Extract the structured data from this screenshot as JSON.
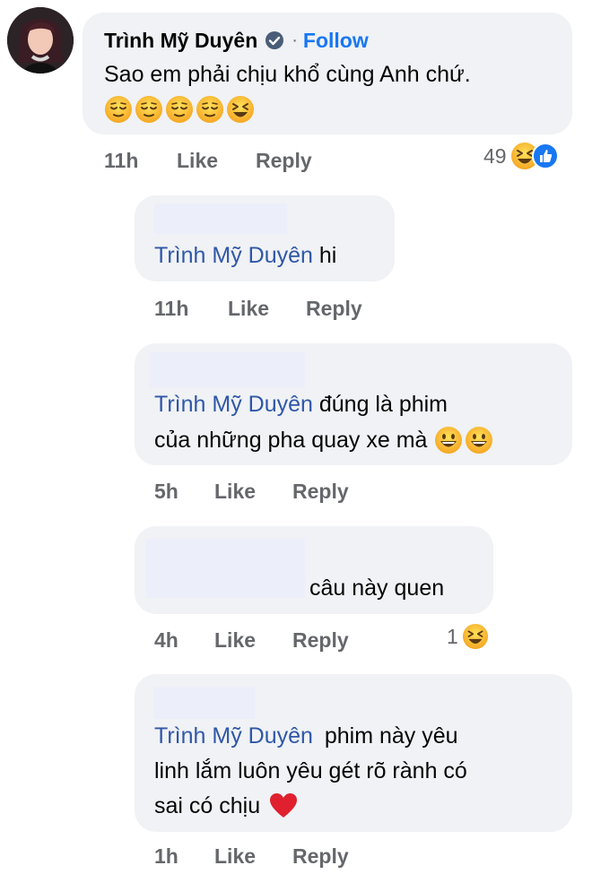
{
  "main_comment": {
    "author": "Trình Mỹ Duyên",
    "follow_label": "Follow",
    "separator": "·",
    "text": "Sao em phải chịu khổ cùng Anh chứ.",
    "emojis": [
      "relieved-face-icon",
      "relieved-face-icon",
      "relieved-face-icon",
      "relieved-face-icon",
      "laughing-squinting-face-icon"
    ],
    "time": "11h",
    "like_label": "Like",
    "reply_label": "Reply",
    "reaction_count": "49",
    "reaction_icons": [
      "haha-reaction-icon",
      "like-reaction-icon"
    ]
  },
  "replies": [
    {
      "mention": "Trình Mỹ Duyên",
      "text": "hi",
      "time": "11h",
      "like_label": "Like",
      "reply_label": "Reply"
    },
    {
      "mention": "Trình Mỹ Duyên",
      "text_line1": "đúng là phim",
      "text_line2": "của những pha quay xe mà",
      "emojis": [
        "grinning-face-icon",
        "grinning-face-icon"
      ],
      "time": "5h",
      "like_label": "Like",
      "reply_label": "Reply"
    },
    {
      "text": "câu này quen",
      "time": "4h",
      "like_label": "Like",
      "reply_label": "Reply",
      "reaction_count": "1",
      "reaction_icons": [
        "haha-reaction-icon"
      ]
    },
    {
      "mention": "Trình Mỹ Duyên",
      "text_line1": "phim này yêu",
      "text_line2": "linh lắm luôn yêu gét rõ rành có",
      "text_line3": "sai có chịu",
      "emojis": [
        "red-heart-icon"
      ],
      "time": "1h",
      "like_label": "Like",
      "reply_label": "Reply"
    }
  ],
  "colors": {
    "bubble": "#f0f2f5",
    "mention": "#2f57a8",
    "follow": "#1877f2",
    "meta": "#65676b",
    "redaction": "#eceef9"
  }
}
